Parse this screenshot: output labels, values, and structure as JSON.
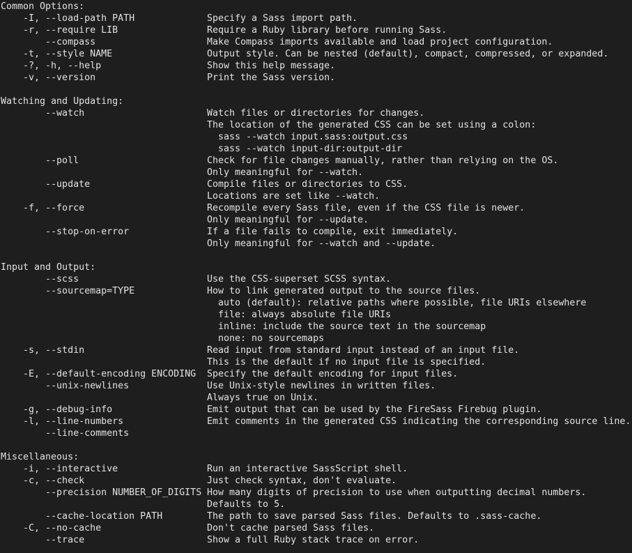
{
  "terminal": {
    "lines": [
      {
        "opt": "Common Options:",
        "desc": ""
      },
      {
        "opt": "    -I, --load-path PATH",
        "desc": "Specify a Sass import path."
      },
      {
        "opt": "    -r, --require LIB",
        "desc": "Require a Ruby library before running Sass."
      },
      {
        "opt": "        --compass",
        "desc": "Make Compass imports available and load project configuration."
      },
      {
        "opt": "    -t, --style NAME",
        "desc": "Output style. Can be nested (default), compact, compressed, or expanded."
      },
      {
        "opt": "    -?, -h, --help",
        "desc": "Show this help message."
      },
      {
        "opt": "    -v, --version",
        "desc": "Print the Sass version."
      },
      {
        "opt": "",
        "desc": ""
      },
      {
        "opt": "Watching and Updating:",
        "desc": ""
      },
      {
        "opt": "        --watch",
        "desc": "Watch files or directories for changes."
      },
      {
        "opt": "",
        "desc": "The location of the generated CSS can be set using a colon:"
      },
      {
        "opt": "",
        "desc": "  sass --watch input.sass:output.css"
      },
      {
        "opt": "",
        "desc": "  sass --watch input-dir:output-dir"
      },
      {
        "opt": "        --poll",
        "desc": "Check for file changes manually, rather than relying on the OS."
      },
      {
        "opt": "",
        "desc": "Only meaningful for --watch."
      },
      {
        "opt": "        --update",
        "desc": "Compile files or directories to CSS."
      },
      {
        "opt": "",
        "desc": "Locations are set like --watch."
      },
      {
        "opt": "    -f, --force",
        "desc": "Recompile every Sass file, even if the CSS file is newer."
      },
      {
        "opt": "",
        "desc": "Only meaningful for --update."
      },
      {
        "opt": "        --stop-on-error",
        "desc": "If a file fails to compile, exit immediately."
      },
      {
        "opt": "",
        "desc": "Only meaningful for --watch and --update."
      },
      {
        "opt": "",
        "desc": ""
      },
      {
        "opt": "Input and Output:",
        "desc": ""
      },
      {
        "opt": "        --scss",
        "desc": "Use the CSS-superset SCSS syntax."
      },
      {
        "opt": "        --sourcemap=TYPE",
        "desc": "How to link generated output to the source files."
      },
      {
        "opt": "",
        "desc": "  auto (default): relative paths where possible, file URIs elsewhere"
      },
      {
        "opt": "",
        "desc": "  file: always absolute file URIs"
      },
      {
        "opt": "",
        "desc": "  inline: include the source text in the sourcemap"
      },
      {
        "opt": "",
        "desc": "  none: no sourcemaps"
      },
      {
        "opt": "    -s, --stdin",
        "desc": "Read input from standard input instead of an input file."
      },
      {
        "opt": "",
        "desc": "This is the default if no input file is specified."
      },
      {
        "opt": "    -E, --default-encoding ENCODING",
        "desc": "Specify the default encoding for input files."
      },
      {
        "opt": "        --unix-newlines",
        "desc": "Use Unix-style newlines in written files."
      },
      {
        "opt": "",
        "desc": "Always true on Unix."
      },
      {
        "opt": "    -g, --debug-info",
        "desc": "Emit output that can be used by the FireSass Firebug plugin."
      },
      {
        "opt": "    -l, --line-numbers",
        "desc": "Emit comments in the generated CSS indicating the corresponding source line."
      },
      {
        "opt": "        --line-comments",
        "desc": ""
      },
      {
        "opt": "",
        "desc": ""
      },
      {
        "opt": "Miscellaneous:",
        "desc": ""
      },
      {
        "opt": "    -i, --interactive",
        "desc": "Run an interactive SassScript shell."
      },
      {
        "opt": "    -c, --check",
        "desc": "Just check syntax, don't evaluate."
      },
      {
        "opt": "        --precision NUMBER_OF_DIGITS",
        "desc": "How many digits of precision to use when outputting decimal numbers."
      },
      {
        "opt": "",
        "desc": "Defaults to 5."
      },
      {
        "opt": "        --cache-location PATH",
        "desc": "The path to save parsed Sass files. Defaults to .sass-cache."
      },
      {
        "opt": "    -C, --no-cache",
        "desc": "Don't cache parsed Sass files."
      },
      {
        "opt": "        --trace",
        "desc": "Show a full Ruby stack trace on error."
      }
    ]
  }
}
